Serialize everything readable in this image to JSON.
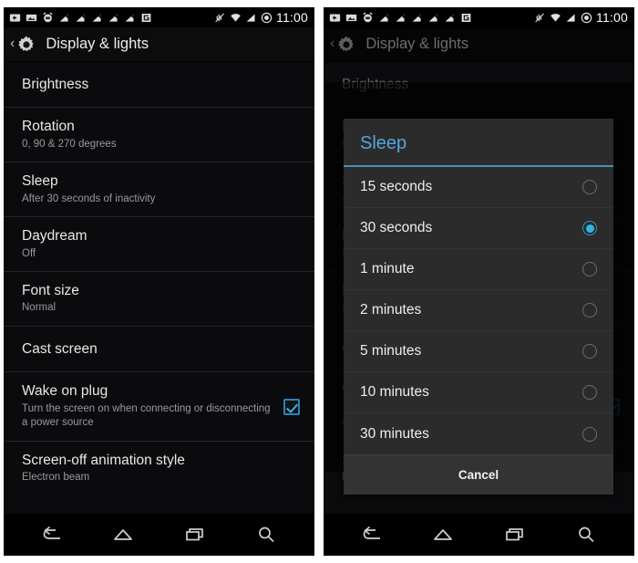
{
  "statusbar": {
    "icons": [
      "back-arrow-badge-icon",
      "image-icon",
      "alarm-clock-icon",
      "signal-cut-icon",
      "signal-cut-icon",
      "signal-cut-icon",
      "signal-cut-icon",
      "signal-cut-icon",
      "g-network-icon",
      "vibrate-mute-icon",
      "wifi-icon",
      "cell-signal-icon",
      "do-not-disturb-icon"
    ],
    "clock": "11:00"
  },
  "actionbar": {
    "back_chevron": "‹",
    "title": "Display & lights"
  },
  "settings": {
    "rows": [
      {
        "title": "Brightness",
        "subtitle": "",
        "control": "none"
      },
      {
        "title": "Rotation",
        "subtitle": "0, 90 & 270 degrees",
        "control": "none"
      },
      {
        "title": "Sleep",
        "subtitle": "After 30 seconds of inactivity",
        "control": "none"
      },
      {
        "title": "Daydream",
        "subtitle": "Off",
        "control": "none"
      },
      {
        "title": "Font size",
        "subtitle": "Normal",
        "control": "none"
      },
      {
        "title": "Cast screen",
        "subtitle": "",
        "control": "none"
      },
      {
        "title": "Wake on plug",
        "subtitle": "Turn the screen on when connecting or disconnecting a power source",
        "control": "checkbox",
        "checked": true
      },
      {
        "title": "Screen-off animation style",
        "subtitle": "Electron beam",
        "control": "none"
      }
    ]
  },
  "dialog": {
    "title": "Sleep",
    "options": [
      {
        "label": "15 seconds",
        "selected": false
      },
      {
        "label": "30 seconds",
        "selected": true
      },
      {
        "label": "1 minute",
        "selected": false
      },
      {
        "label": "2 minutes",
        "selected": false
      },
      {
        "label": "5 minutes",
        "selected": false
      },
      {
        "label": "10 minutes",
        "selected": false
      },
      {
        "label": "30 minutes",
        "selected": false
      }
    ],
    "cancel_label": "Cancel"
  },
  "navbar": {
    "buttons": [
      "back-icon",
      "home-icon",
      "recents-icon",
      "search-icon"
    ]
  },
  "colors": {
    "accent": "#33b5e5",
    "dialog_title": "#54a7d8",
    "dialog_bg": "#2b2b2b",
    "list_bg": "#0b0b0d",
    "actionbar_bg": "#0c0c0c"
  }
}
